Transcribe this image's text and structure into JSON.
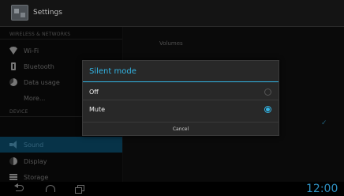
{
  "app": {
    "title": "Settings"
  },
  "sidebar": {
    "sections": [
      {
        "header": "WIRELESS & NETWORKS"
      },
      {
        "header": "DEVICE"
      }
    ],
    "items": [
      {
        "label": "Wi-Fi",
        "icon": "wifi-icon"
      },
      {
        "label": "Bluetooth",
        "icon": "bluetooth-icon"
      },
      {
        "label": "Data usage",
        "icon": "data-usage-icon"
      },
      {
        "label": "More...",
        "icon": ""
      },
      {
        "label": "Sound",
        "icon": "sound-icon",
        "selected": true
      },
      {
        "label": "Display",
        "icon": "display-icon"
      },
      {
        "label": "Storage",
        "icon": "storage-icon"
      }
    ]
  },
  "main": {
    "volumes_label": "Volumes"
  },
  "dialog": {
    "title": "Silent mode",
    "options": [
      {
        "label": "Off",
        "selected": false
      },
      {
        "label": "Mute",
        "selected": true
      }
    ],
    "cancel_label": "Cancel"
  },
  "navbar": {
    "clock": "12:00"
  },
  "colors": {
    "accent": "#33b5e5",
    "selected_bg": "#0e5d84"
  }
}
